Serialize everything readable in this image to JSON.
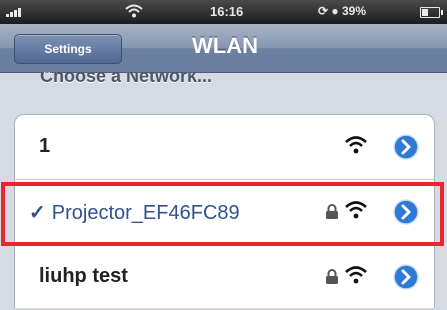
{
  "status_bar": {
    "time": "16:16",
    "battery": "39%",
    "icons": [
      "signal-icon",
      "wifi-icon",
      "lock-rotation-icon",
      "location-icon",
      "battery-icon"
    ]
  },
  "nav": {
    "back_label": "Settings",
    "title": "WLAN"
  },
  "section_header": "Choose a Network...",
  "networks": [
    {
      "name": "1",
      "secured": false,
      "connected": false
    },
    {
      "name": "Projector_EF46FC89",
      "secured": true,
      "connected": true,
      "checkmark": "✓"
    },
    {
      "name": "liuhp test",
      "secured": true,
      "connected": false
    }
  ],
  "colors": {
    "highlight": "#e8262c",
    "selected_text": "#31518f",
    "detail_blue": "#2f7ad6"
  }
}
